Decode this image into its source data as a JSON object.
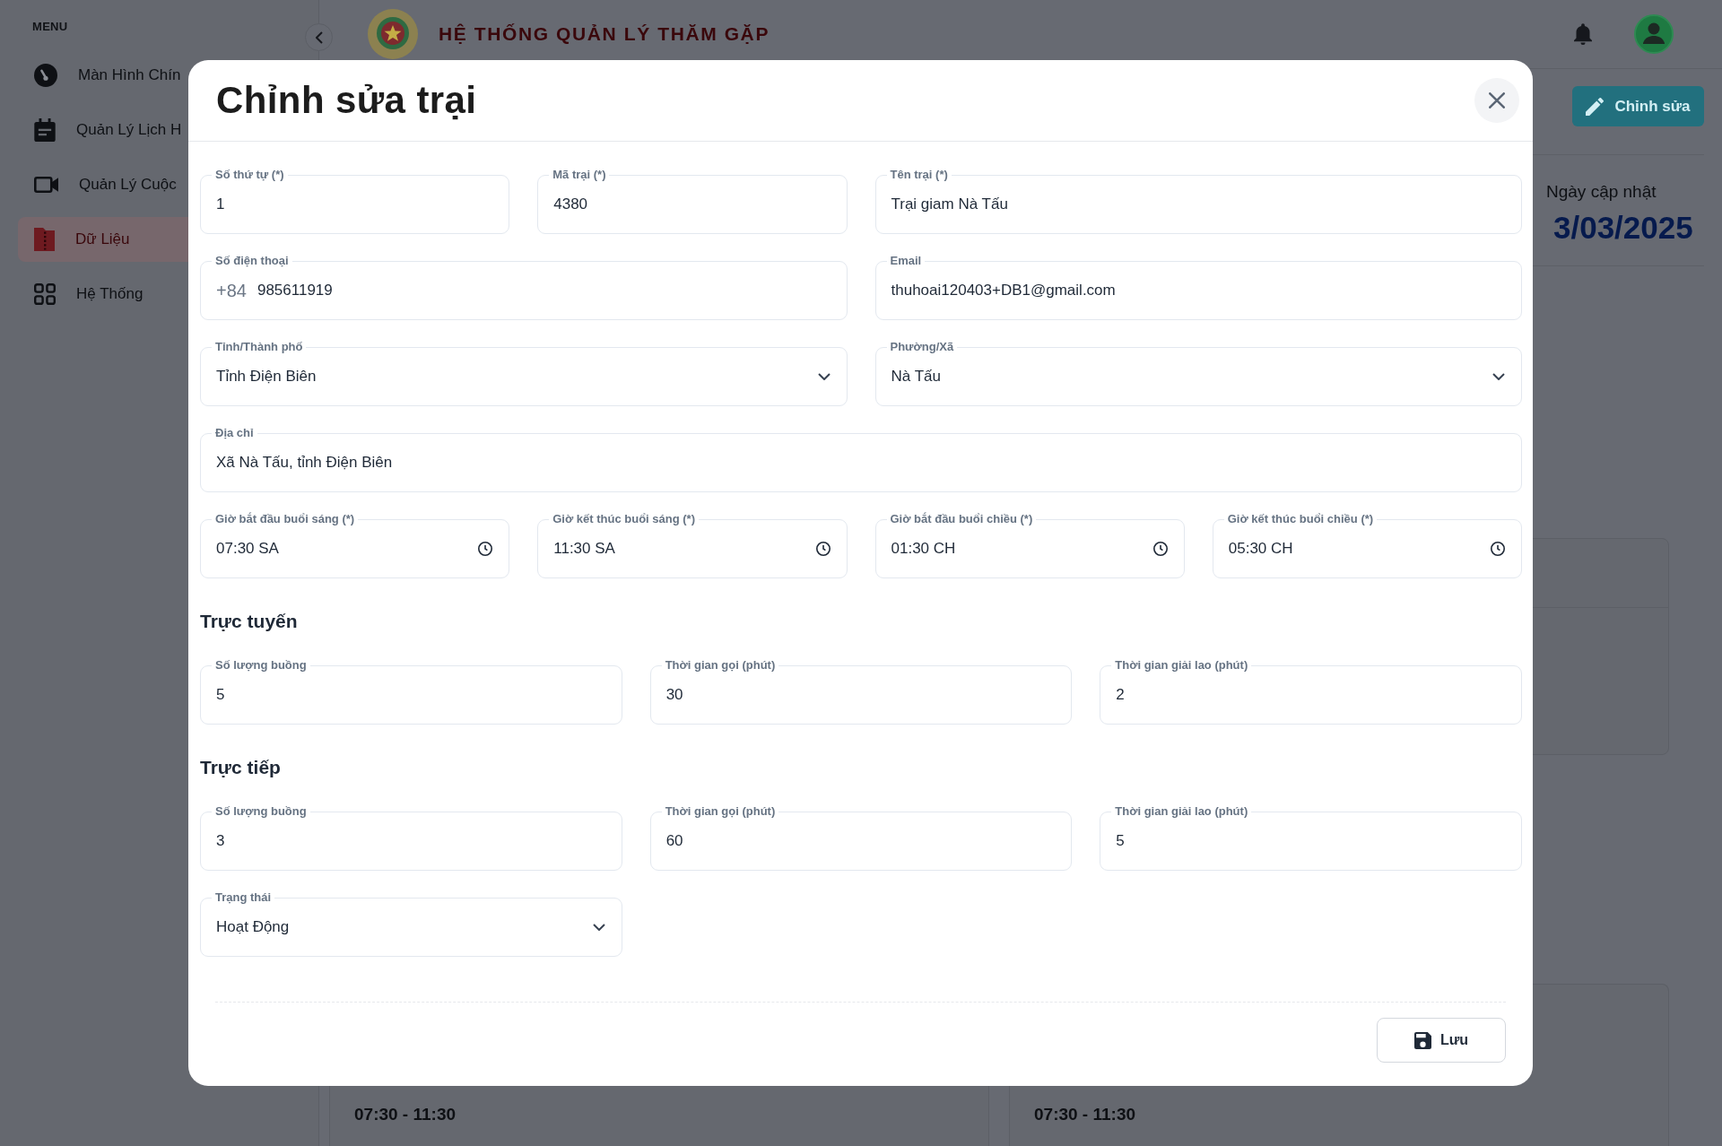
{
  "sidebar": {
    "heading": "MENU",
    "items": [
      {
        "label": "Màn Hình Chín",
        "selected": false
      },
      {
        "label": "Quản Lý Lịch H",
        "selected": false
      },
      {
        "label": "Quản Lý Cuộc",
        "selected": false
      },
      {
        "label": "Dữ Liệu",
        "selected": true
      },
      {
        "label": "Hệ Thống",
        "selected": false
      }
    ]
  },
  "header": {
    "title": "HỆ THỐNG QUẢN LÝ THĂM GẶP"
  },
  "page": {
    "edit_button": "Chỉnh sửa",
    "updated_label": "Ngày cập nhật",
    "updated_date": "3/03/2025",
    "time_ranges": [
      "07:30 - 11:30",
      "07:30 - 11:30"
    ]
  },
  "modal": {
    "title": "Chỉnh sửa trại",
    "rows": [
      [
        {
          "kind": "text",
          "label": "Số thứ tự (*)",
          "value": "1"
        },
        {
          "kind": "text",
          "label": "Mã trại (*)",
          "value": "4380"
        },
        {
          "kind": "text",
          "label": "Tên trại (*)",
          "value": "Trại giam Nà Tấu"
        }
      ],
      [
        {
          "kind": "phone",
          "label": "Số điện thoại",
          "prefix": "+84",
          "value": "985611919"
        },
        {
          "kind": "text",
          "label": "Email",
          "value": "thuhoai120403+DB1@gmail.com"
        }
      ],
      [
        {
          "kind": "select",
          "label": "Tỉnh/Thành phố",
          "value": "Tỉnh Điện Biên"
        },
        {
          "kind": "select",
          "label": "Phường/Xã",
          "value": "Nà Tấu"
        }
      ],
      [
        {
          "kind": "text",
          "label": "Địa chỉ",
          "value": "Xã Nà Tấu, tỉnh Điện Biên"
        }
      ],
      [
        {
          "kind": "time",
          "label": "Giờ bắt đầu buổi sáng (*)",
          "value": "07:30 SA"
        },
        {
          "kind": "time",
          "label": "Giờ kết thúc buổi sáng (*)",
          "value": "11:30 SA"
        },
        {
          "kind": "time",
          "label": "Giờ bắt đầu buổi chiều (*)",
          "value": "01:30 CH"
        },
        {
          "kind": "time",
          "label": "Giờ kết thúc buổi chiều (*)",
          "value": "05:30 CH"
        }
      ]
    ],
    "sections": [
      {
        "heading": "Trực tuyến",
        "rows": [
          [
            {
              "kind": "text",
              "label": "Số lượng buồng",
              "value": "5"
            },
            {
              "kind": "text",
              "label": "Thời gian gọi (phút)",
              "value": "30"
            },
            {
              "kind": "text",
              "label": "Thời gian giải lao (phút)",
              "value": "2"
            }
          ]
        ]
      },
      {
        "heading": "Trực tiếp",
        "rows": [
          [
            {
              "kind": "text",
              "label": "Số lượng buồng",
              "value": "3"
            },
            {
              "kind": "text",
              "label": "Thời gian gọi (phút)",
              "value": "60"
            },
            {
              "kind": "text",
              "label": "Thời gian giải lao (phút)",
              "value": "5"
            }
          ],
          [
            {
              "kind": "select",
              "label": "Trạng thái",
              "value": "Hoạt Động"
            }
          ]
        ]
      }
    ],
    "save_button": "Lưu"
  }
}
